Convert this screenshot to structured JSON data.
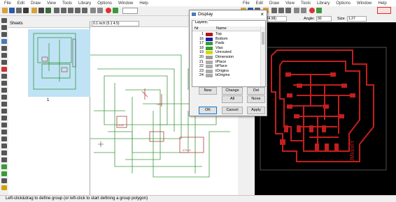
{
  "left_menu": [
    "File",
    "Edit",
    "Draw",
    "View",
    "Tools",
    "Library",
    "Options",
    "Window",
    "Help"
  ],
  "right_menu": [
    "File",
    "Edit",
    "Draw",
    "View",
    "Tools",
    "Library",
    "Options",
    "Window",
    "Help"
  ],
  "sheets": {
    "title": "Sheets",
    "page_number": "1"
  },
  "schematic": {
    "coordinate": "0.1 inch (5.1 4.5)",
    "grid_combo": "·"
  },
  "board": {
    "coordinate": "(1.47 34.98)",
    "angle_label": "Angle:",
    "angle_value": "90",
    "size_label": "Size",
    "size_value": "1.27",
    "board_label": "JMidorlY"
  },
  "status": {
    "text": "Left-click&drag to define group (or left-click to start defining a group polygon)"
  },
  "dialog": {
    "title": "Display",
    "layers_label": "Layers:",
    "col_nr": "Nr",
    "col_name": "Name",
    "layers": [
      {
        "nr": "1",
        "name": "Top",
        "color": "#b01818"
      },
      {
        "nr": "16",
        "name": "Bottom",
        "color": "#1c1cb0"
      },
      {
        "nr": "17",
        "name": "Pads",
        "color": "#3a9a3a"
      },
      {
        "nr": "18",
        "name": "Vias",
        "color": "#3a9a3a"
      },
      {
        "nr": "19",
        "name": "Unrouted",
        "color": "#d8d800"
      },
      {
        "nr": "20",
        "name": "Dimension",
        "color": "#9a9a9a"
      },
      {
        "nr": "21",
        "name": "tPlace",
        "color": "#aaaaaa"
      },
      {
        "nr": "22",
        "name": "bPlace",
        "color": "#aaaaaa"
      },
      {
        "nr": "23",
        "name": "tOrigins",
        "color": "#aaaaaa"
      },
      {
        "nr": "24",
        "name": "bOrigins",
        "color": "#aaaaaa"
      }
    ],
    "buttons": {
      "new": "New",
      "change": "Change",
      "del": "Del",
      "all": "All",
      "none": "None",
      "ok": "OK",
      "cancel": "Cancel",
      "apply": "Apply"
    }
  }
}
